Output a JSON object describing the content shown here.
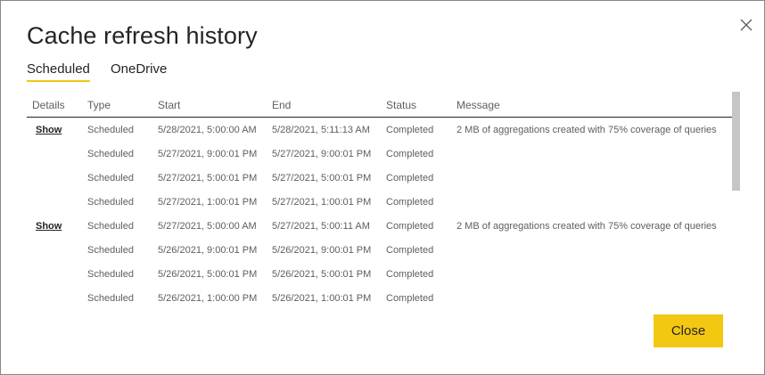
{
  "dialog": {
    "title": "Cache refresh history",
    "close_icon": "close-icon",
    "close_button_label": "Close"
  },
  "tabs": [
    {
      "label": "Scheduled",
      "active": true
    },
    {
      "label": "OneDrive",
      "active": false
    }
  ],
  "table": {
    "columns": [
      "Details",
      "Type",
      "Start",
      "End",
      "Status",
      "Message"
    ],
    "rows": [
      {
        "details": "Show",
        "type": "Scheduled",
        "start": "5/28/2021, 5:00:00 AM",
        "end": "5/28/2021, 5:11:13 AM",
        "status": "Completed",
        "message": "2 MB of aggregations created with 75% coverage of queries"
      },
      {
        "details": "",
        "type": "Scheduled",
        "start": "5/27/2021, 9:00:01 PM",
        "end": "5/27/2021, 9:00:01 PM",
        "status": "Completed",
        "message": ""
      },
      {
        "details": "",
        "type": "Scheduled",
        "start": "5/27/2021, 5:00:01 PM",
        "end": "5/27/2021, 5:00:01 PM",
        "status": "Completed",
        "message": ""
      },
      {
        "details": "",
        "type": "Scheduled",
        "start": "5/27/2021, 1:00:01 PM",
        "end": "5/27/2021, 1:00:01 PM",
        "status": "Completed",
        "message": ""
      },
      {
        "details": "Show",
        "type": "Scheduled",
        "start": "5/27/2021, 5:00:00 AM",
        "end": "5/27/2021, 5:00:11 AM",
        "status": "Completed",
        "message": "2 MB of aggregations created with 75% coverage of queries"
      },
      {
        "details": "",
        "type": "Scheduled",
        "start": "5/26/2021, 9:00:01 PM",
        "end": "5/26/2021, 9:00:01 PM",
        "status": "Completed",
        "message": ""
      },
      {
        "details": "",
        "type": "Scheduled",
        "start": "5/26/2021, 5:00:01 PM",
        "end": "5/26/2021, 5:00:01 PM",
        "status": "Completed",
        "message": ""
      },
      {
        "details": "",
        "type": "Scheduled",
        "start": "5/26/2021, 1:00:00 PM",
        "end": "5/26/2021, 1:00:01 PM",
        "status": "Completed",
        "message": ""
      }
    ]
  },
  "colors": {
    "accent": "#f2c811",
    "text": "#252423",
    "muted_text": "#605e5c",
    "scrollbar_thumb": "#c8c6c4"
  }
}
